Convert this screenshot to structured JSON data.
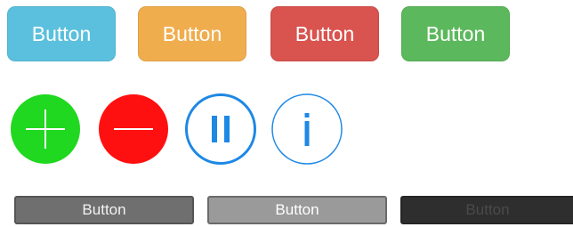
{
  "flat_buttons": [
    {
      "label": "Button",
      "color": "#5bc0de"
    },
    {
      "label": "Button",
      "color": "#f0ad4e"
    },
    {
      "label": "Button",
      "color": "#d9534f"
    },
    {
      "label": "Button",
      "color": "#5cb85c"
    }
  ],
  "circle_buttons": [
    {
      "icon": "plus-icon",
      "color": "#1fd81f"
    },
    {
      "icon": "minus-icon",
      "color": "#ff1010"
    },
    {
      "icon": "pause-icon",
      "color": "#1e88e5"
    },
    {
      "icon": "info-icon",
      "color": "#1e88e5"
    }
  ],
  "bar_buttons": [
    {
      "label": "Button",
      "state": "normal"
    },
    {
      "label": "Button",
      "state": "highlighted"
    },
    {
      "label": "Button",
      "state": "disabled"
    }
  ]
}
